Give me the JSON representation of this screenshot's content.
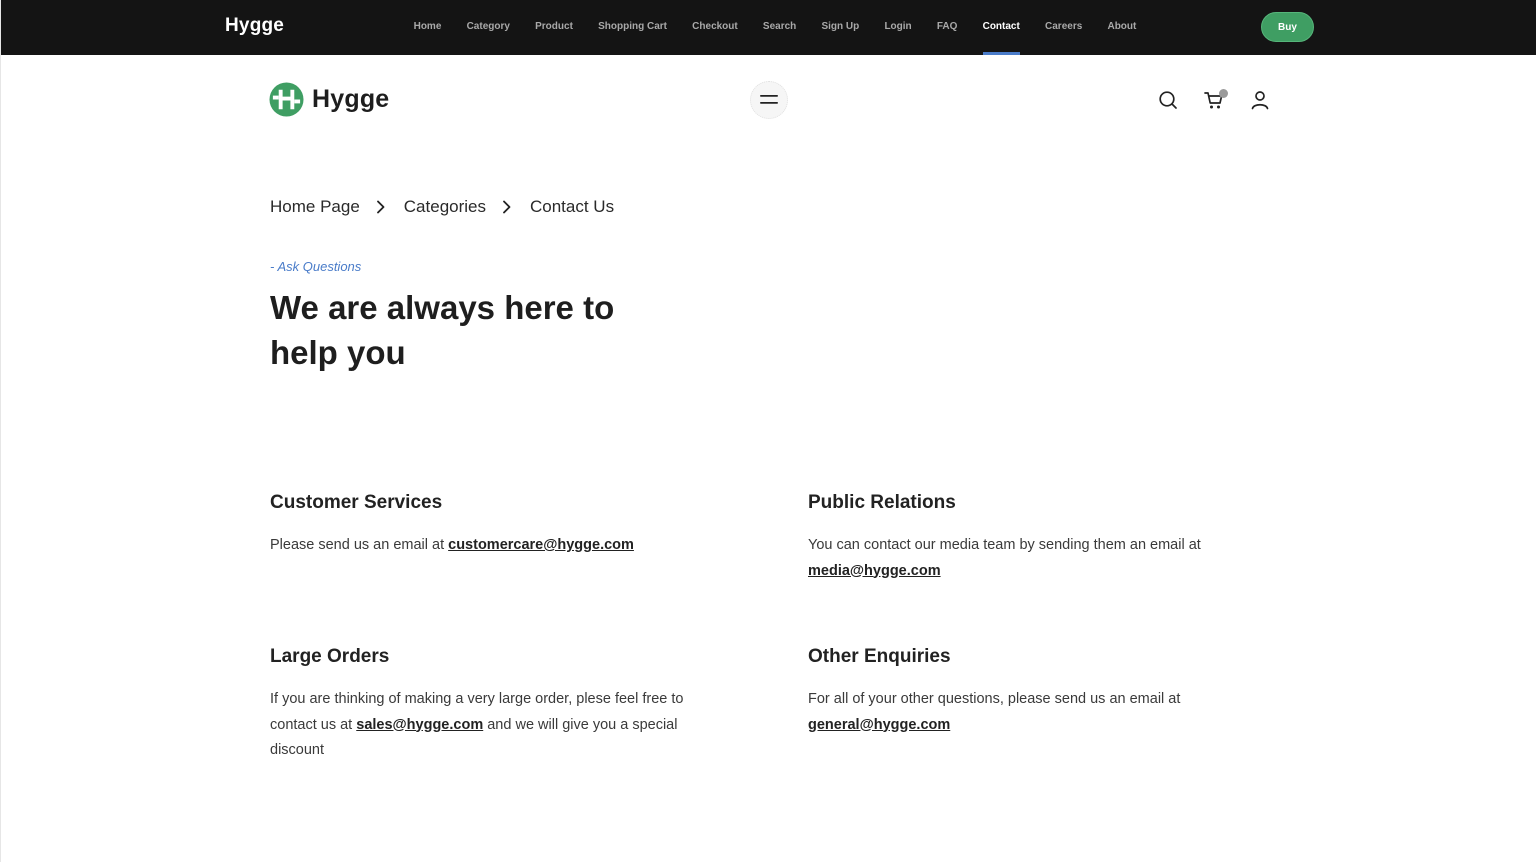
{
  "topbar": {
    "logo": "Hygge",
    "nav": [
      "Home",
      "Category",
      "Product",
      "Shopping Cart",
      "Checkout",
      "Search",
      "Sign Up",
      "Login",
      "FAQ",
      "Contact",
      "Careers",
      "About"
    ],
    "active_nav": "Contact",
    "buy_label": "Buy",
    "accent_color": "#4a7cc9",
    "buy_color": "#3f9e63"
  },
  "header": {
    "brand_name": "Hygge",
    "icons": [
      "hamburger-menu-icon",
      "search-icon",
      "cart-icon",
      "user-icon"
    ]
  },
  "breadcrumb": [
    "Home Page",
    "Categories",
    "Contact Us"
  ],
  "hero": {
    "eyebrow": "- Ask Questions",
    "title": "We are always here to help you"
  },
  "contacts": {
    "customer_services": {
      "title": "Customer Services",
      "text_before": "Please send us an email at ",
      "email": "customercare@hygge.com"
    },
    "public_relations": {
      "title": "Public Relations",
      "text_before": "You can contact our media team by sending them an email at ",
      "email": "media@hygge.com"
    },
    "large_orders": {
      "title": "Large Orders",
      "text_before": "If you are thinking of making a very large order, plese feel free to contact us at ",
      "email": "sales@hygge.com",
      "text_after": " and we will give you a special discount"
    },
    "other_enquiries": {
      "title": "Other Enquiries",
      "text_before": "For all of your other questions, please send us an email at ",
      "email": "general@hygge.com"
    }
  }
}
